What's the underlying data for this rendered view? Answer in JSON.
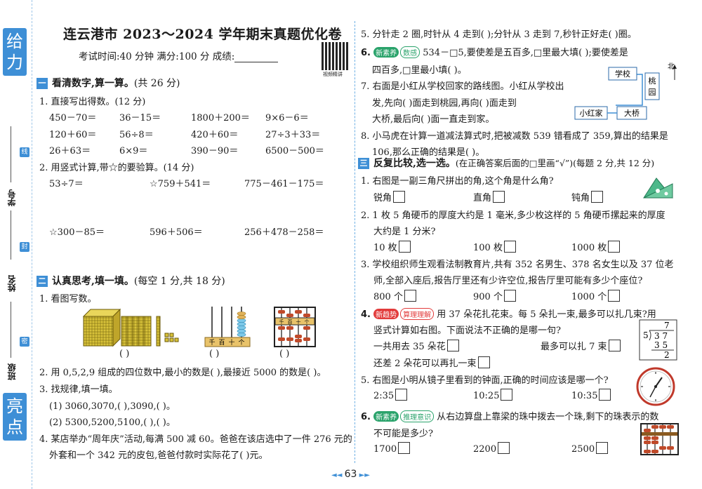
{
  "strip": {
    "top_tab": "给力",
    "bottom_tab": "亮点",
    "label_xuehao": "学号",
    "label_xingming": "姓名",
    "label_banji": "班级",
    "cut_marks": [
      "线",
      "封",
      "密"
    ]
  },
  "header": {
    "title": "连云港市 2023～2024 学年期末真题优化卷",
    "meta": "考试时间:40 分钟   满分:100 分   成绩:",
    "qr_label": "视频精讲"
  },
  "section1": {
    "num": "一",
    "title": "看清数字,算一算。",
    "note": "(共 26 分)",
    "q1": "1. 直接写出得数。(12 分)",
    "q1_items": [
      [
        "450－70＝",
        "36－15＝",
        "1800＋200＝",
        "9×6－6＝"
      ],
      [
        "120＋60＝",
        "56÷8＝",
        "420＋60＝",
        "27÷3＋33＝"
      ],
      [
        "26＋63＝",
        "6×9＝",
        "390－90＝",
        "6500－500＝"
      ]
    ],
    "q2": "2. 用竖式计算,带☆的要验算。(14 分)",
    "q2_row1": [
      "53÷7＝",
      "☆759＋541＝",
      "775－461－175＝"
    ],
    "q2_row2": [
      "☆300－85＝",
      "596＋506＝",
      "256＋478－258＝"
    ]
  },
  "section2": {
    "num": "二",
    "title": "认真思考,填一填。",
    "note": "(每空 1 分,共 18 分)",
    "q1": "1. 看图写数。",
    "blank": "(      )",
    "abacus_labels": [
      "千",
      "百",
      "十",
      "个"
    ],
    "q2": "2. 用 0,5,2,9 组成的四位数中,最小的数是(    ),最接近 5000 的数是(    )。",
    "q3": "3. 找规律,填一填。",
    "q3_1": "(1) 3060,3070,(      ),3090,(      )。",
    "q3_2": "(2) 5300,5200,5100,(      ),(      )。",
    "q4_line1": "4. 某店举办“周年庆”活动,每满 500 减 60。爸爸在该店选中了一件 276 元的",
    "q4_line2": "外套和一个 342 元的皮包,爸爸付款时实际花了(      )元。"
  },
  "right_top": {
    "q5": "5. 分针走 2 圈,时针从 4 走到(    );分针从 3 走到 7,秒针正好走(      )圈。",
    "q6_tag1": "新素养",
    "q6_tag2": "数感",
    "q6_line1": "534－□5,要使差是五百多,□里最大填(      );要使差是",
    "q6_line2": "四百多,□里最小填(      )。",
    "q7_line1": "7. 右面是小红从学校回家的路线图。小红从学校出",
    "q7_line2": "发,先向(      )面走到桃园,再向(      )面走到",
    "q7_line3": "大桥,最后向(      )面一直走到家。",
    "map_labels": [
      "学校",
      "桃园",
      "大桥",
      "小红家",
      "北"
    ],
    "q8_line1": "8. 小马虎在计算一道减法算式时,把被减数 539 错看成了 359,算出的结果是",
    "q8_line2": "106,那么正确的结果是(      )。"
  },
  "section3": {
    "num": "三",
    "title": "反复比较,选一选。",
    "note": "(在正确答案后面的□里画“√”)(每题 2 分,共 12 分)",
    "q1": "1. 右图是一副三角尺拼出的角,这个角是什么角?",
    "q1_opts": [
      "锐角",
      "直角",
      "钝角"
    ],
    "q2_line1": "2. 1 枚 5 角硬币的厚度大约是 1 毫米,多少枚这样的 5 角硬币摞起来的厚度",
    "q2_line2": "大约是 1 分米?",
    "q2_opts": [
      "10 枚",
      "100 枚",
      "1000 枚"
    ],
    "q3_line1": "3. 学校组织师生观看法制教育片,共有 352 名男生、378 名女生以及 37 位老",
    "q3_line2": "师,全部入座后,报告厅里还有少许空位,报告厅里可能有多少个座位?",
    "q3_opts": [
      "800 个",
      "900 个",
      "1000 个"
    ],
    "q4_tag1": "新趋势",
    "q4_tag2": "算理理解",
    "q4_line1": "用 37 朵花扎花束。每 5 朵扎一束,最多可以扎几束?用",
    "q4_line2": "竖式计算如右图。下面说法不正确的是哪一句?",
    "q4_opt1": "一共用去 35 朵花",
    "q4_opt2": "最多可以扎 7 束",
    "q4_opt3": "还差 2 朵花可以再扎一束",
    "division": {
      "quotient": "7",
      "divisor": "5",
      "dividend": "3 7",
      "product": "3 5",
      "remainder": "2"
    },
    "q5": "5. 右图是小明从镜子里看到的钟面,正确的时间应该是哪一个?",
    "q5_opts": [
      "2:35",
      "10:25",
      "10:35"
    ],
    "q6_tag1": "新素养",
    "q6_tag2": "推理意识",
    "q6_line1": "从右边算盘上靠梁的珠中拨去一个珠,剩下的珠表示的数",
    "q6_line2": "不可能是多少?",
    "q6_opts": [
      "1700",
      "2200",
      "2500"
    ]
  },
  "footer": {
    "page": "63"
  }
}
